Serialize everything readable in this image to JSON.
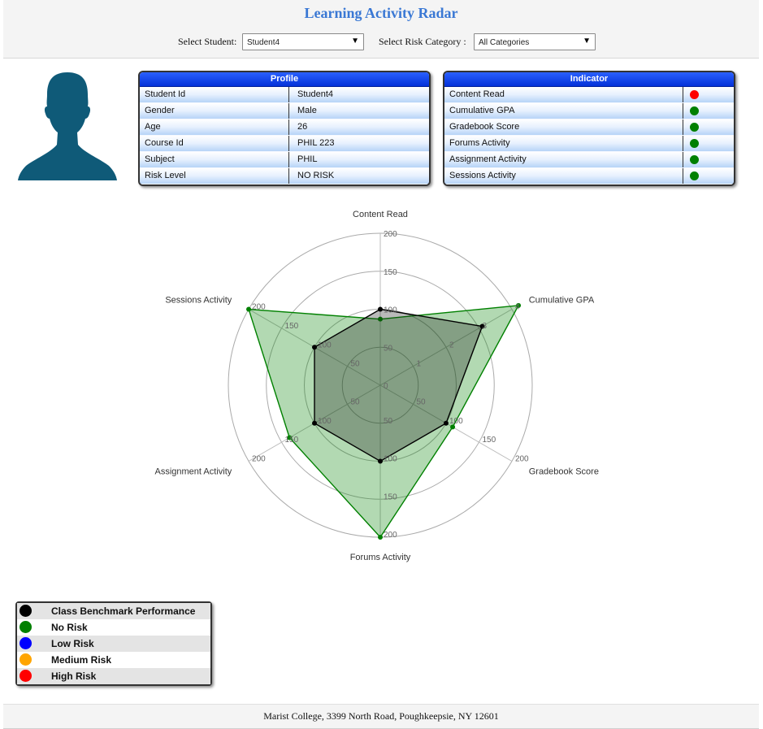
{
  "header": {
    "title": "Learning Activity Radar",
    "student_label": "Select Student:",
    "student_value": "Student4",
    "risk_label": "Select Risk Category :",
    "risk_value": "All Categories"
  },
  "profile": {
    "title": "Profile",
    "rows": [
      {
        "label": "Student Id",
        "value": "Student4"
      },
      {
        "label": "Gender",
        "value": "Male"
      },
      {
        "label": "Age",
        "value": "26"
      },
      {
        "label": "Course Id",
        "value": "PHIL 223"
      },
      {
        "label": "Subject",
        "value": "PHIL"
      },
      {
        "label": "Risk Level",
        "value": "NO RISK"
      }
    ]
  },
  "indicator": {
    "title": "Indicator",
    "rows": [
      {
        "label": "Content Read",
        "status": "high-risk",
        "color": "#ff0000"
      },
      {
        "label": "Cumulative GPA",
        "status": "no-risk",
        "color": "#008000"
      },
      {
        "label": "Gradebook Score",
        "status": "no-risk",
        "color": "#008000"
      },
      {
        "label": "Forums Activity",
        "status": "no-risk",
        "color": "#008000"
      },
      {
        "label": "Assignment Activity",
        "status": "no-risk",
        "color": "#008000"
      },
      {
        "label": "Sessions Activity",
        "status": "no-risk",
        "color": "#008000"
      }
    ]
  },
  "chart_data": {
    "type": "radar",
    "axes": [
      {
        "label": "Content Read",
        "max": 200,
        "ticks": [
          "0",
          "50",
          "100",
          "150",
          "200"
        ]
      },
      {
        "label": "Cumulative GPA",
        "max": 4,
        "ticks": [
          "1",
          "2",
          "3",
          "4"
        ]
      },
      {
        "label": "Gradebook Score",
        "max": 200,
        "ticks": [
          "50",
          "100",
          "150",
          "200"
        ]
      },
      {
        "label": "Forums Activity",
        "max": 200,
        "ticks": [
          "50",
          "100",
          "150",
          "200"
        ]
      },
      {
        "label": "Assignment Activity",
        "max": 200,
        "ticks": [
          "50",
          "100",
          "150",
          "200"
        ]
      },
      {
        "label": "Sessions Activity",
        "max": 200,
        "ticks": [
          "50",
          "100",
          "150",
          "200"
        ]
      }
    ],
    "series": [
      {
        "name": "Class Benchmark Performance",
        "color": "#000000",
        "fill": "#1a1a1a",
        "values": [
          100,
          3.1,
          100,
          100,
          100,
          100
        ]
      },
      {
        "name": "No Risk",
        "color": "#008000",
        "fill": "#008000",
        "values": [
          87,
          4.2,
          110,
          200,
          138,
          200
        ]
      }
    ],
    "gridlines": true
  },
  "legend": [
    {
      "label": "Class Benchmark Performance",
      "color": "#000000"
    },
    {
      "label": "No Risk",
      "color": "#008000"
    },
    {
      "label": "Low Risk",
      "color": "#0000ff"
    },
    {
      "label": "Medium Risk",
      "color": "#ffa500"
    },
    {
      "label": "High Risk",
      "color": "#ff0000"
    }
  ],
  "footer": {
    "text": "Marist College, 3399 North Road, Poughkeepsie, NY 12601"
  }
}
